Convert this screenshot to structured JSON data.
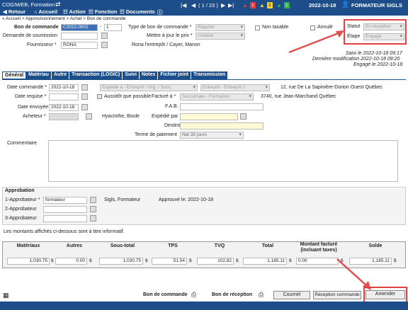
{
  "app": {
    "title": "COGIWEB, Formation",
    "record": "( 1 / 23 )",
    "date": "2022-10-18",
    "user": "FORMATEUR SIGLS"
  },
  "badges": [
    {
      "value": "1",
      "color": "#e83a3a"
    },
    {
      "value": "2",
      "color": "#f4d13c"
    },
    {
      "value": "1",
      "color": "#2fb24a"
    }
  ],
  "toolbar": {
    "retour": "Retour",
    "accueil": "Accueil",
    "action": "Action",
    "fonction": "Fonction",
    "documents": "Documents"
  },
  "breadcrumb": "» Accueil > Approvisionnement > Achat > Bon de commande",
  "header": {
    "bon_commande_label": "Bon de commande",
    "bon_commande_value": "C2022-0002",
    "bon_commande_seq": "1",
    "demande_label": "Demande de soumission",
    "fournisseur_label": "Fournisseur *",
    "fournisseur_value": "RONA",
    "fournisseur_address": "Rona l'entrepôt / Cayer, Manon",
    "type_label": "Type de bon de commande *",
    "type_value": "Régulier",
    "mettre_label": "Mettre à jour le prix *",
    "mettre_value": "Unitaire",
    "non_taxable": "Non taxable",
    "annule": "Annulé",
    "statut_label": "Statut",
    "statut_value": "En réception",
    "etape_label": "Étape",
    "etape_value": "Engagé",
    "saisi": "Saisi le 2022-10-18 09:17",
    "derniere_mod": "Dernière modification 2022-10-18 09:20",
    "engage": "Engagé le 2022-10-18"
  },
  "tabs": [
    "Général",
    "Matériau",
    "Autre",
    "Transaction (LOGIC)",
    "Suivi",
    "Notes",
    "Fichier joint",
    "Transmission"
  ],
  "general": {
    "date_commande_label": "Date commande *",
    "date_commande_value": "2022-10-18",
    "expedie_label": "Expédié à - Entrepôt / Org. / Succ.",
    "expedie_value": "Entrepôt - Entrepôt 1",
    "expedie_address": "12, rue De La Sapinière-Dorion Ouest Québec",
    "date_requise_label": "Date requise *",
    "assistuf_label": "Aussitôt que possible",
    "facture_label": "Facturé à *",
    "facture_value": "Succursale - Formation",
    "facture_address": "3740, rue Jean-Marchand Québec",
    "fab_label": "F.A.B.",
    "date_envoyee_label": "Date envoyée",
    "date_envoyee_value": "2022-10-18",
    "acheteur_label": "Acheteur *",
    "acheteur_name": "Hyacinthe, Boule",
    "expedie_par_label": "Expédié par",
    "destine_label": "Destiné à",
    "terme_label": "Terme de paiement",
    "terme_value": "Net 30 jours",
    "commentaire_label": "Commentaire"
  },
  "approbation": {
    "title": "Approbation",
    "a1_label": "1-Approbateur *",
    "a1_value": "formateur",
    "a1_name": "Sigls, Formateur",
    "a1_approved": "Approuvé le: 2022-10-18",
    "a2_label": "2-Approbateur",
    "a3_label": "3-Approbateur"
  },
  "note": "Les montants affichés ci-dessous sont à titre informatif.",
  "totals": {
    "headers": [
      "Matériaux",
      "Autres",
      "Sous-total",
      "TPS",
      "TVQ",
      "Total",
      "Montant facturé (incluant taxes)",
      "Solde"
    ],
    "values": [
      "1,030.75",
      "0.00",
      "1,030.75",
      "51.54",
      "102.82",
      "1,185.11",
      "0.00",
      "1,185.11"
    ],
    "currency": "$"
  },
  "footer": {
    "bon_commande": "Bon de commande",
    "bon_reception": "Bon de réception",
    "courriel": "Courriel",
    "reception_commande": "Réception commande",
    "amender": "Amender"
  }
}
